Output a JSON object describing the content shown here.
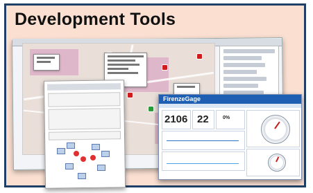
{
  "slide": {
    "title": "Development Tools"
  },
  "dashboard": {
    "title": "FirenzeGage",
    "value_1": "2106",
    "value_2": "22",
    "value_3": "0%"
  },
  "colors": {
    "frame_border": "#1f3f66",
    "background": "#fbe0d2",
    "accent": "#1e5fb3",
    "marker": "#d01c1c"
  }
}
